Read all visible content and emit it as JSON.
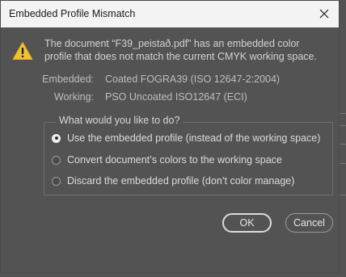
{
  "dialog": {
    "title": "Embedded Profile Mismatch",
    "message": "The document “F39_peistað.pdf” has an embedded color profile that does not match the current CMYK working space.",
    "embedded_label": "Embedded:",
    "embedded_value": "Coated FOGRA39 (ISO 12647-2:2004)",
    "working_label": "Working:",
    "working_value": "PSO Uncoated ISO12647 (ECI)",
    "group_label": "What would you like to do?",
    "options": [
      {
        "label": "Use the embedded profile (instead of the working space)",
        "selected": true
      },
      {
        "label": "Convert document’s colors to the working space",
        "selected": false
      },
      {
        "label": "Discard the embedded profile (don’t color manage)",
        "selected": false
      }
    ],
    "ok_label": "OK",
    "cancel_label": "Cancel"
  },
  "colors": {
    "background": "#535353",
    "titlebar": "#f3f3f3",
    "warning": "#f2c12e"
  },
  "icons": {
    "warning": "warning-icon",
    "close": "close-icon"
  }
}
